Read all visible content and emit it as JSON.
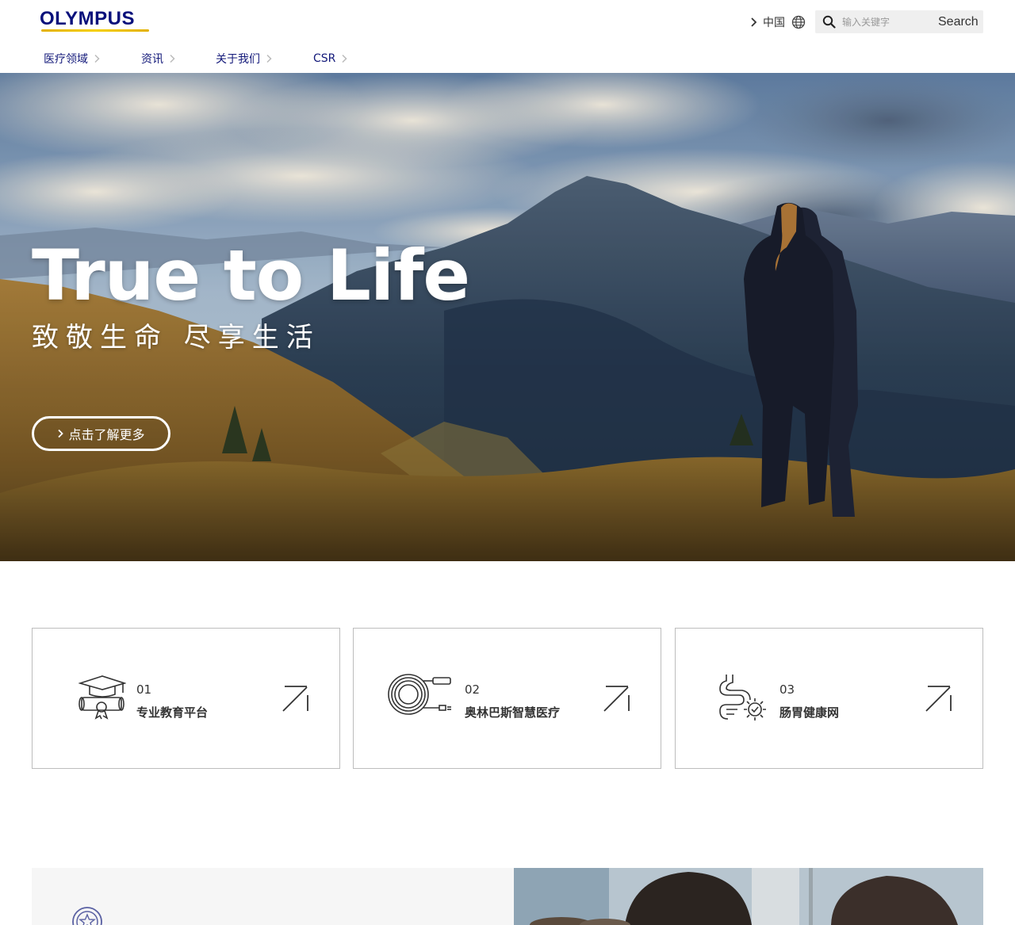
{
  "brand": {
    "logo_text": "OLYMPUS"
  },
  "header": {
    "region_label": "中国",
    "search": {
      "placeholder": "输入关键字",
      "button_label": "Search"
    }
  },
  "nav": {
    "items": [
      {
        "label": "医疗领域"
      },
      {
        "label": "资讯"
      },
      {
        "label": "关于我们"
      },
      {
        "label": "CSR"
      }
    ]
  },
  "hero": {
    "title": "True to Life",
    "subtitle": "致敬生命 尽享生活",
    "cta_label": "点击了解更多"
  },
  "cards": [
    {
      "number": "01",
      "label": "专业教育平台",
      "icon": "graduation-cap-diploma-icon"
    },
    {
      "number": "02",
      "label": "奥林巴斯智慧医疗",
      "icon": "endoscope-coil-icon"
    },
    {
      "number": "03",
      "label": "肠胃健康网",
      "icon": "intestine-gear-icon"
    }
  ],
  "colors": {
    "brand_navy": "#08107b",
    "nav_text": "#13197a",
    "logo_gold": "#e3b100",
    "card_border": "#bdbdbd",
    "search_bg": "#efefef"
  }
}
